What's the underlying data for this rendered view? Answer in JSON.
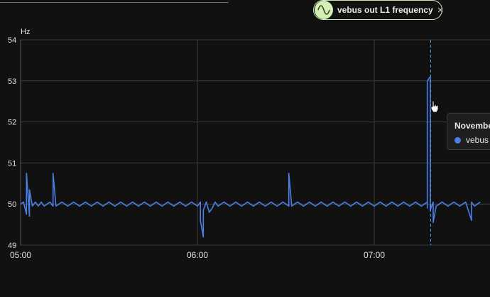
{
  "legend": {
    "series_label": "vebus out L1 frequency",
    "icon": "sine-wave-icon",
    "close_icon": "close-icon",
    "close_glyph": "×",
    "chip_color": "#d4efb6"
  },
  "tooltip": {
    "date_text": "November",
    "series_text": "vebus o"
  },
  "chart_data": {
    "type": "line",
    "ylabel": "Hz",
    "ylim": [
      49,
      54
    ],
    "yticks": [
      "49",
      "50",
      "51",
      "52",
      "53",
      "54"
    ],
    "xlim": [
      "05:00",
      "07:36"
    ],
    "xticks": [
      "05:00",
      "06:00",
      "07:00"
    ],
    "grid": true,
    "hover_x": "07:19",
    "series": [
      {
        "color": "#4d7ee6",
        "points": [
          [
            "05:00",
            50.0
          ],
          [
            "05:01",
            50.05
          ],
          [
            "05:02",
            49.75
          ],
          [
            "05:02",
            50.75
          ],
          [
            "05:03",
            49.7
          ],
          [
            "05:03",
            50.35
          ],
          [
            "05:04",
            49.95
          ],
          [
            "05:05",
            50.05
          ],
          [
            "05:06",
            49.95
          ],
          [
            "05:07",
            50.05
          ],
          [
            "05:08",
            49.95
          ],
          [
            "05:09",
            50.0
          ],
          [
            "05:10",
            50.05
          ],
          [
            "05:11",
            49.95
          ],
          [
            "05:11",
            50.75
          ],
          [
            "05:12",
            49.95
          ],
          [
            "05:14",
            50.05
          ],
          [
            "05:16",
            49.95
          ],
          [
            "05:18",
            50.05
          ],
          [
            "05:20",
            49.95
          ],
          [
            "05:22",
            50.05
          ],
          [
            "05:24",
            49.95
          ],
          [
            "05:26",
            50.05
          ],
          [
            "05:28",
            49.95
          ],
          [
            "05:30",
            50.05
          ],
          [
            "05:32",
            49.95
          ],
          [
            "05:34",
            50.05
          ],
          [
            "05:36",
            49.95
          ],
          [
            "05:38",
            50.05
          ],
          [
            "05:40",
            49.95
          ],
          [
            "05:42",
            50.05
          ],
          [
            "05:44",
            49.95
          ],
          [
            "05:46",
            50.05
          ],
          [
            "05:48",
            49.95
          ],
          [
            "05:50",
            50.05
          ],
          [
            "05:52",
            49.95
          ],
          [
            "05:54",
            50.05
          ],
          [
            "05:56",
            49.95
          ],
          [
            "05:58",
            50.05
          ],
          [
            "06:00",
            49.95
          ],
          [
            "06:01",
            50.05
          ],
          [
            "06:01",
            49.6
          ],
          [
            "06:02",
            49.2
          ],
          [
            "06:02",
            49.85
          ],
          [
            "06:03",
            50.05
          ],
          [
            "06:04",
            49.8
          ],
          [
            "06:05",
            49.9
          ],
          [
            "06:06",
            50.05
          ],
          [
            "06:07",
            49.95
          ],
          [
            "06:09",
            50.05
          ],
          [
            "06:11",
            49.95
          ],
          [
            "06:13",
            50.05
          ],
          [
            "06:15",
            49.95
          ],
          [
            "06:17",
            50.05
          ],
          [
            "06:19",
            49.95
          ],
          [
            "06:21",
            50.05
          ],
          [
            "06:23",
            49.95
          ],
          [
            "06:25",
            50.05
          ],
          [
            "06:27",
            49.95
          ],
          [
            "06:29",
            50.05
          ],
          [
            "06:31",
            49.95
          ],
          [
            "06:31",
            50.75
          ],
          [
            "06:32",
            49.95
          ],
          [
            "06:34",
            50.05
          ],
          [
            "06:36",
            49.95
          ],
          [
            "06:38",
            50.05
          ],
          [
            "06:40",
            49.95
          ],
          [
            "06:42",
            50.05
          ],
          [
            "06:44",
            49.95
          ],
          [
            "06:46",
            50.05
          ],
          [
            "06:48",
            49.95
          ],
          [
            "06:50",
            50.05
          ],
          [
            "06:52",
            49.95
          ],
          [
            "06:54",
            50.05
          ],
          [
            "06:56",
            49.95
          ],
          [
            "06:58",
            50.05
          ],
          [
            "07:00",
            49.95
          ],
          [
            "07:02",
            50.05
          ],
          [
            "07:04",
            49.95
          ],
          [
            "07:06",
            50.05
          ],
          [
            "07:08",
            49.95
          ],
          [
            "07:10",
            50.05
          ],
          [
            "07:12",
            49.95
          ],
          [
            "07:14",
            50.05
          ],
          [
            "07:16",
            49.95
          ],
          [
            "07:18",
            50.05
          ],
          [
            "07:18",
            49.9
          ],
          [
            "07:18",
            50.35
          ],
          [
            "07:18",
            53.0
          ],
          [
            "07:19",
            53.1
          ],
          [
            "07:19",
            49.85
          ],
          [
            "07:20",
            50.05
          ],
          [
            "07:20",
            49.55
          ],
          [
            "07:21",
            49.95
          ],
          [
            "07:23",
            50.05
          ],
          [
            "07:25",
            49.95
          ],
          [
            "07:27",
            50.05
          ],
          [
            "07:29",
            49.95
          ],
          [
            "07:31",
            50.05
          ],
          [
            "07:33",
            49.6
          ],
          [
            "07:33",
            50.05
          ],
          [
            "07:34",
            49.95
          ],
          [
            "07:36",
            50.05
          ]
        ]
      }
    ]
  }
}
